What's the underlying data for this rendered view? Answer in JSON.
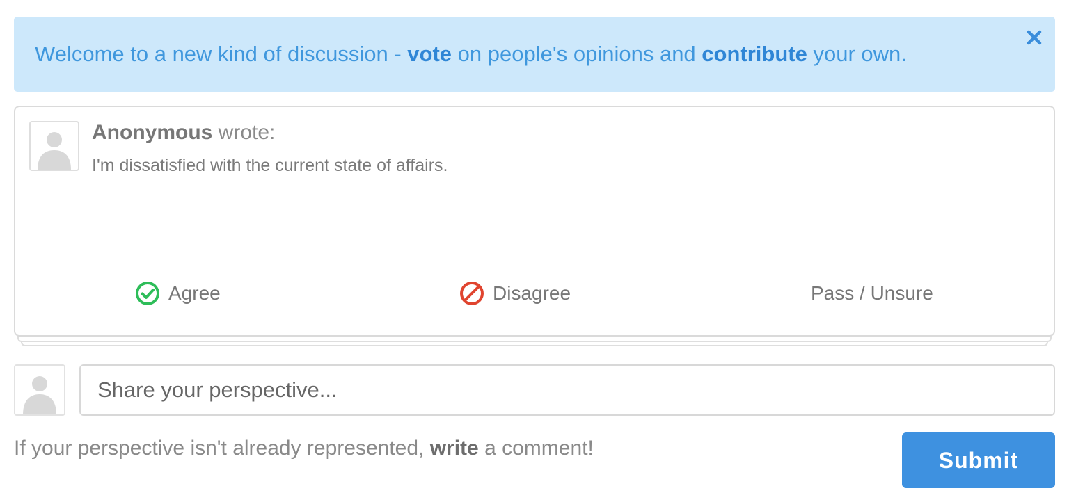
{
  "banner": {
    "text_prefix": "Welcome to a new kind of discussion - ",
    "vote_word": "vote",
    "text_middle": " on people's opinions and ",
    "contribute_word": "contribute",
    "text_suffix": " your own.",
    "close_icon": "close-icon"
  },
  "card": {
    "avatar_icon": "user-silhouette-icon",
    "author": "Anonymous",
    "wrote": " wrote:",
    "comment": "I'm dissatisfied with the current state of affairs.",
    "agree_label": "Agree",
    "disagree_label": "Disagree",
    "pass_label": "Pass / Unsure"
  },
  "compose": {
    "avatar_icon": "user-silhouette-icon",
    "placeholder": "Share your perspective...",
    "value": "",
    "hint_prefix": "If your perspective isn't already represented, ",
    "hint_bold": "write",
    "hint_suffix": " a comment!",
    "submit_label": "Submit"
  },
  "colors": {
    "banner_bg": "#cde8fb",
    "banner_text": "#3f97dd",
    "agree_green": "#2ebd59",
    "disagree_red": "#e0442f",
    "submit_blue": "#3e91e0"
  }
}
